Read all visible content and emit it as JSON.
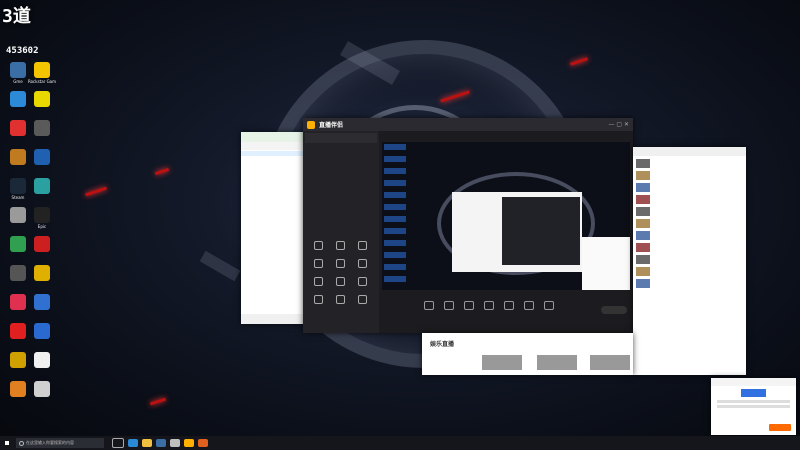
{
  "overlay": {
    "logo": "3道",
    "count": "453602"
  },
  "desktop_icons": [
    {
      "label": "Gme",
      "color": "#3a6ea5"
    },
    {
      "label": "Rockstar Games",
      "color": "#f5c400"
    },
    {
      "label": "",
      "color": "#2d8ad6"
    },
    {
      "label": "",
      "color": "#e8d800"
    },
    {
      "label": "",
      "color": "#e03030"
    },
    {
      "label": "",
      "color": "#5a5a5a"
    },
    {
      "label": "",
      "color": "#c07a20"
    },
    {
      "label": "",
      "color": "#2060b0"
    },
    {
      "label": "Steam",
      "color": "#1b2838"
    },
    {
      "label": "",
      "color": "#2aa0a0"
    },
    {
      "label": "",
      "color": "#9a9a9a"
    },
    {
      "label": "Epic",
      "color": "#222222"
    },
    {
      "label": "",
      "color": "#30a050"
    },
    {
      "label": "",
      "color": "#cc2020"
    },
    {
      "label": "",
      "color": "#555555"
    },
    {
      "label": "",
      "color": "#e0b000"
    },
    {
      "label": "",
      "color": "#e03050"
    },
    {
      "label": "",
      "color": "#3070d0"
    },
    {
      "label": "",
      "color": "#e02020"
    },
    {
      "label": "",
      "color": "#2a6ad0"
    },
    {
      "label": "",
      "color": "#d0a000"
    },
    {
      "label": "",
      "color": "#f0f0f0"
    },
    {
      "label": "",
      "color": "#e08020"
    },
    {
      "label": "",
      "color": "#d0d0d0"
    }
  ],
  "obs": {
    "app_title": "直播伴侣",
    "start_label": "",
    "tools": [
      {
        "label": ""
      },
      {
        "label": ""
      },
      {
        "label": ""
      },
      {
        "label": ""
      },
      {
        "label": ""
      },
      {
        "label": ""
      },
      {
        "label": ""
      }
    ]
  },
  "browser": {
    "items": [
      {
        "text": ""
      },
      {
        "text": ""
      },
      {
        "text": ""
      },
      {
        "text": ""
      },
      {
        "text": ""
      },
      {
        "text": ""
      },
      {
        "text": ""
      },
      {
        "text": ""
      },
      {
        "text": ""
      },
      {
        "text": ""
      },
      {
        "text": ""
      }
    ]
  },
  "entertainment": {
    "brand": "娱乐直播"
  },
  "notice": {
    "title": "",
    "button": ""
  },
  "taskbar": {
    "search_placeholder": "在这里输入你要搜索的内容"
  }
}
